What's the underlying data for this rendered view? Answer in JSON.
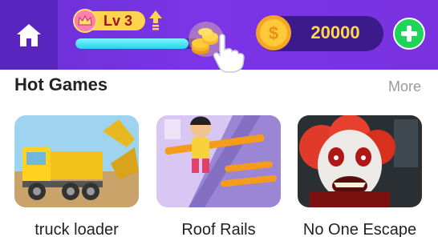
{
  "topbar": {
    "level_label": "Lv 3",
    "xp_progress": 0.88,
    "coin_balance": "20000",
    "icons": {
      "home": "home-icon",
      "crown": "crown-icon",
      "level_up": "arrow-up-icon",
      "coin_stack": "coin-stack-icon",
      "hand": "hand-pointer-icon",
      "coin": "dollar-coin-icon",
      "add": "plus-icon"
    }
  },
  "hot_games": {
    "title": "Hot Games",
    "more_label": "More",
    "games": [
      {
        "name": "truck loader"
      },
      {
        "name": "Roof Rails"
      },
      {
        "name": "No One Escape"
      }
    ]
  },
  "colors": {
    "header_purple": "#7432e0",
    "home_purple": "#5a24c0",
    "coin_gold": "#ffd94a",
    "plus_green": "#1ed55a",
    "xp_cyan": "#28d3ea"
  }
}
